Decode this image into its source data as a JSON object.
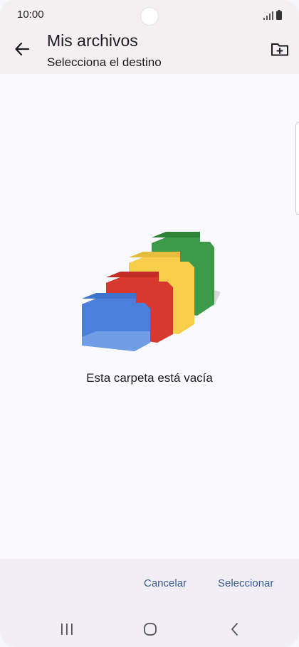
{
  "status_bar": {
    "time": "10:00",
    "icons": [
      "signal-icon",
      "battery-icon"
    ]
  },
  "app_bar": {
    "title": "Mis archivos",
    "subtitle": "Selecciona el destino",
    "icons": [
      "back-arrow-icon",
      "new-folder-icon"
    ]
  },
  "content": {
    "empty_message": "Esta carpeta está vacía",
    "illustration": "empty-folders-icon",
    "colors": {
      "blue": "#4a7fdc",
      "red": "#d8392f",
      "yellow": "#f6ce4a",
      "green": "#3d9a48"
    }
  },
  "actions": {
    "cancel_label": "Cancelar",
    "select_label": "Seleccionar",
    "accent_color": "#3a5a92"
  },
  "nav_bar": {
    "icons": [
      "recents-icon",
      "home-icon",
      "nav-back-icon"
    ]
  }
}
